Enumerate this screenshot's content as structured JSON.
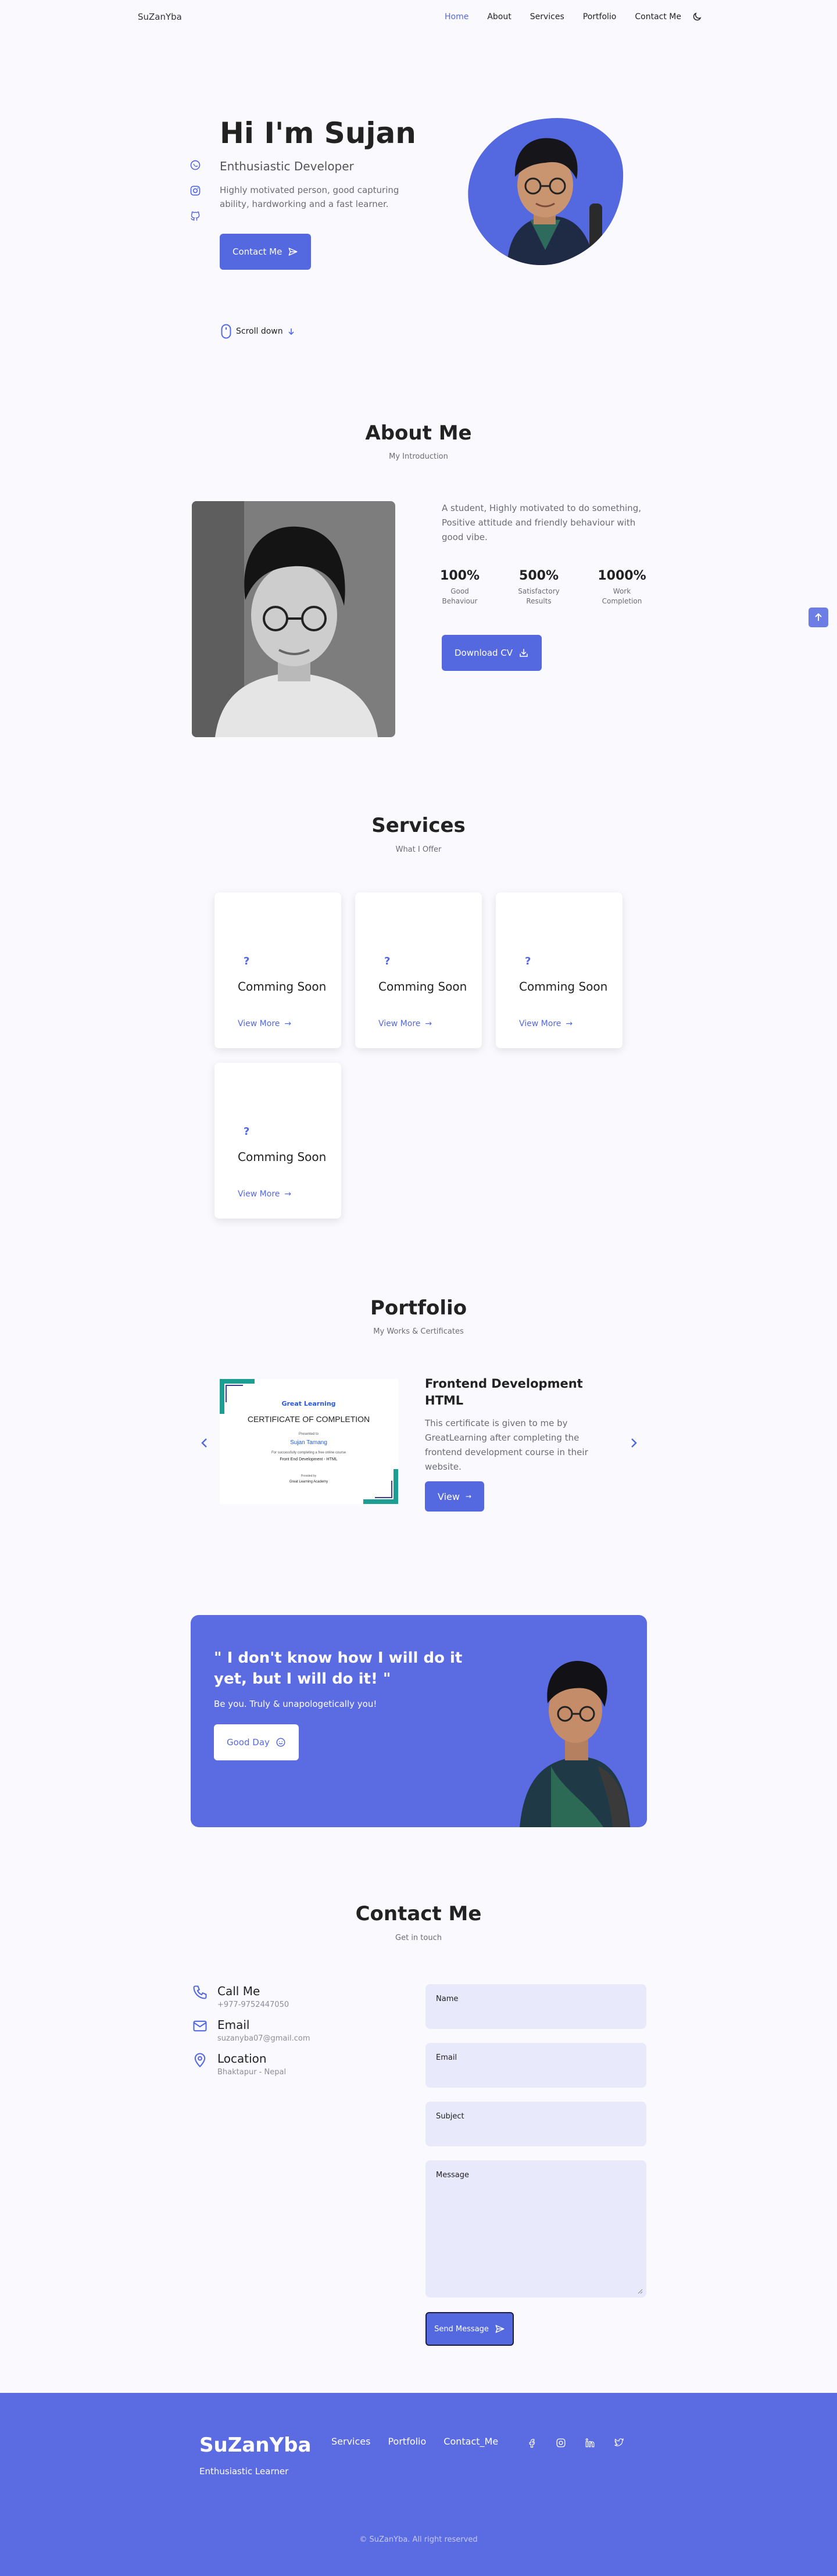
{
  "header": {
    "logo": "SuZanYba",
    "nav": [
      "Home",
      "About",
      "Services",
      "Portfolio",
      "Contact Me"
    ],
    "icon": "moon-icon"
  },
  "hero": {
    "title": "Hi I'm Sujan",
    "subtitle": "Enthusiastic Developer",
    "description": "Highly motivated person, good capturing ability, hardworking and a fast learner.",
    "contact_button": "Contact Me",
    "scroll_label": "Scroll down",
    "social_icons": [
      "whatsapp-icon",
      "instagram-icon",
      "github-icon"
    ]
  },
  "about": {
    "title": "About Me",
    "subtitle": "My Introduction",
    "description": "A student, Highly motivated to do something, Positive attitude and friendly behaviour with good vibe.",
    "stats": [
      {
        "value": "100%",
        "label": "Good Behaviour"
      },
      {
        "value": "500%",
        "label": "Satisfactory Results"
      },
      {
        "value": "1000%",
        "label": "Work Completion"
      }
    ],
    "cv_button": "Download CV"
  },
  "services": {
    "title": "Services",
    "subtitle": "What I Offer",
    "cards": [
      {
        "title": "Comming Soon",
        "link": "View More"
      },
      {
        "title": "Comming Soon",
        "link": "View More"
      },
      {
        "title": "Comming Soon",
        "link": "View More"
      },
      {
        "title": "Comming Soon",
        "link": "View More"
      }
    ]
  },
  "portfolio": {
    "title": "Portfolio",
    "subtitle": "My Works & Certificates",
    "item_title": "Frontend Development HTML",
    "item_description": "This certificate is given to me by GreatLearning after completing the frontend development course in their website.",
    "view_button": "View",
    "certificate": {
      "brand": "Great Learning",
      "heading": "CERTIFICATE OF COMPLETION",
      "presented": "Presented to",
      "name": "Sujan Tamang",
      "line1": "For successfully completing a free online course",
      "course": "Front End Development - HTML",
      "provided": "Provided by",
      "academy": "Great Learning Academy"
    }
  },
  "banner": {
    "quote": "\" I don't know how I will do it yet, but I will do it! \"",
    "sub": "Be you. Truly & unapologetically you!",
    "button": "Good Day"
  },
  "contact": {
    "title": "Contact Me",
    "subtitle": "Get in touch",
    "info": [
      {
        "title": "Call Me",
        "value": "+977-9752447050",
        "icon": "phone-icon"
      },
      {
        "title": "Email",
        "value": "suzanyba07@gmail.com",
        "icon": "mail-icon"
      },
      {
        "title": "Location",
        "value": "Bhaktapur - Nepal",
        "icon": "location-icon"
      }
    ],
    "fields": [
      "Name",
      "Email",
      "Subject",
      "Message"
    ],
    "send_button": "Send Message"
  },
  "footer": {
    "logo": "SuZanYba",
    "subtitle": "Enthusiastic Learner",
    "links": [
      "Services",
      "Portfolio",
      "Contact_Me"
    ],
    "icons": [
      "facebook-icon",
      "instagram-icon",
      "linkedin-icon",
      "twitter-icon"
    ],
    "copyright": "© SuZanYba. All right reserved"
  },
  "colors": {
    "accent": "#5468e0",
    "banner": "#5b6be2",
    "field": "#e8e9fb"
  }
}
